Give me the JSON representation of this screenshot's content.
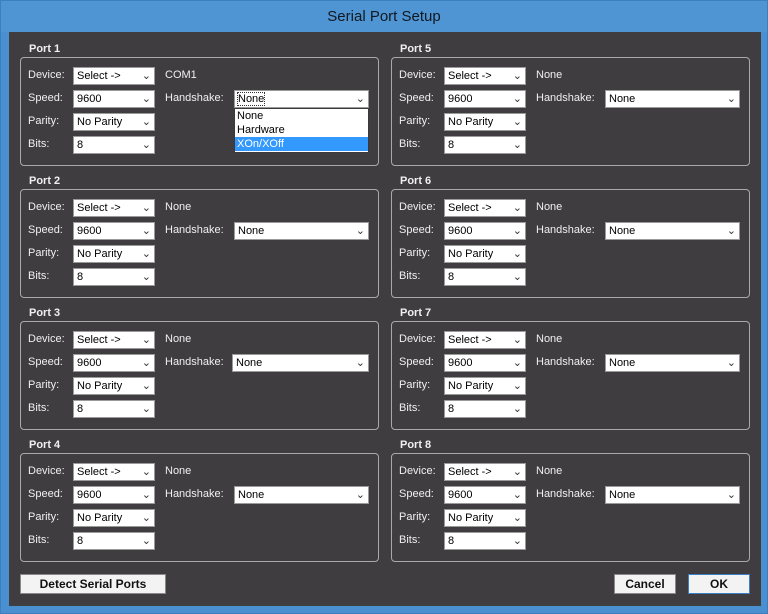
{
  "window": {
    "title": "Serial Port Setup"
  },
  "labels": {
    "device": "Device:",
    "speed": "Speed:",
    "parity": "Parity:",
    "bits": "Bits:",
    "handshake": "Handshake:"
  },
  "ports": [
    {
      "title": "Port 1",
      "device": "Select ->",
      "device_name": "COM1",
      "speed": "9600",
      "parity": "No Parity",
      "bits": "8",
      "handshake": "None"
    },
    {
      "title": "Port 2",
      "device": "Select ->",
      "device_name": "None",
      "speed": "9600",
      "parity": "No Parity",
      "bits": "8",
      "handshake": "None"
    },
    {
      "title": "Port 3",
      "device": "Select ->",
      "device_name": "None",
      "speed": "9600",
      "parity": "No Parity",
      "bits": "8",
      "handshake": "None"
    },
    {
      "title": "Port 4",
      "device": "Select ->",
      "device_name": "None",
      "speed": "9600",
      "parity": "No Parity",
      "bits": "8",
      "handshake": "None"
    },
    {
      "title": "Port 5",
      "device": "Select ->",
      "device_name": "None",
      "speed": "9600",
      "parity": "No Parity",
      "bits": "8",
      "handshake": "None"
    },
    {
      "title": "Port 6",
      "device": "Select ->",
      "device_name": "None",
      "speed": "9600",
      "parity": "No Parity",
      "bits": "8",
      "handshake": "None"
    },
    {
      "title": "Port 7",
      "device": "Select ->",
      "device_name": "None",
      "speed": "9600",
      "parity": "No Parity",
      "bits": "8",
      "handshake": "None"
    },
    {
      "title": "Port 8",
      "device": "Select ->",
      "device_name": "None",
      "speed": "9600",
      "parity": "No Parity",
      "bits": "8",
      "handshake": "None"
    }
  ],
  "handshake_dropdown": {
    "options": [
      "None",
      "Hardware",
      "XOn/XOff"
    ],
    "highlighted": "XOn/XOff"
  },
  "buttons": {
    "detect": "Detect Serial Ports",
    "cancel": "Cancel",
    "ok": "OK"
  }
}
